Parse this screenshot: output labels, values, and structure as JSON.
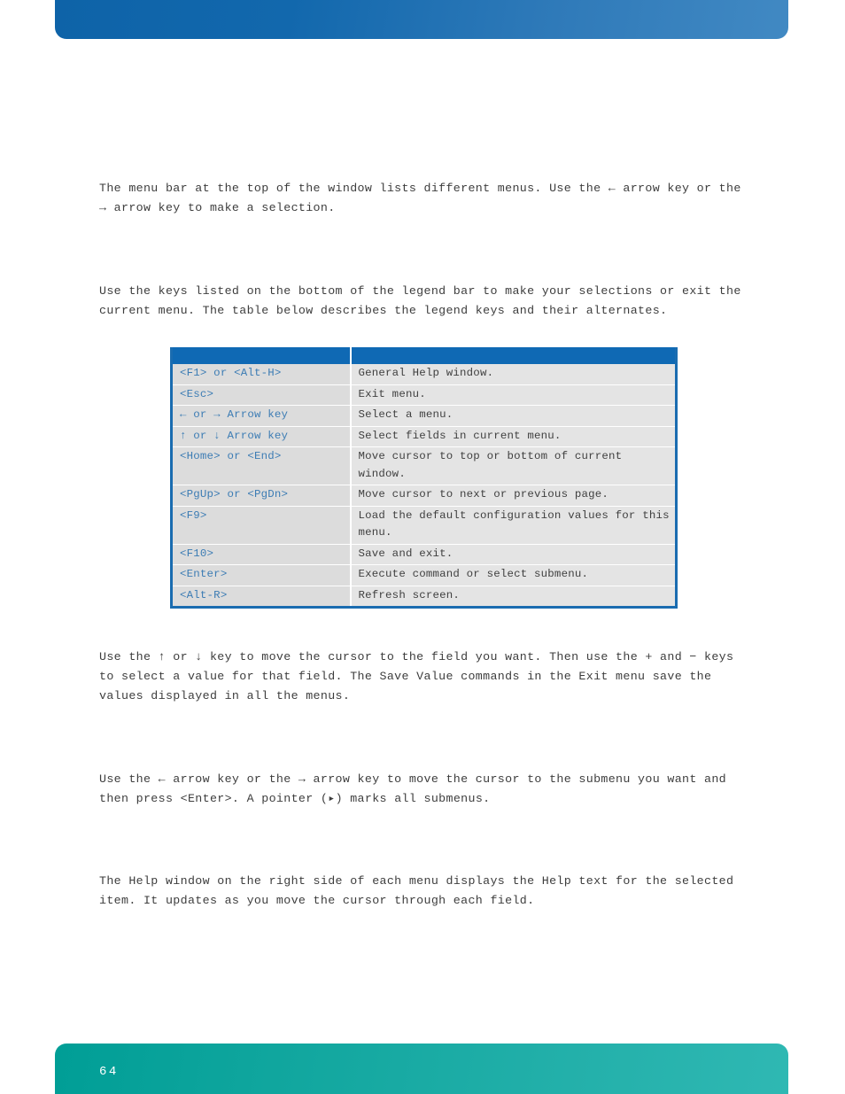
{
  "page": {
    "number": "64",
    "header_color": "#0e63a8",
    "footer_color": "#10a69e",
    "table_border_color": "#1a6cb0",
    "key_text_color": "#3c7cb4"
  },
  "paragraphs": {
    "menu_bar": "The menu bar at the top of the window lists different menus. Use the ← arrow key or the → arrow key to make a selection.",
    "legend_bar": "Use the keys listed on the bottom of the legend bar to make your selections or exit the current menu. The table below describes the legend keys and their alternates.",
    "field_selection": "Use the ↑ or ↓ key to move the cursor to the field you want. Then use the + and − keys to select a value for that field. The Save Value commands in the Exit menu save the values displayed in all the menus.",
    "submenu": "Use the ← arrow key or the → arrow key to move the cursor to the submenu you want and then press <Enter>. A pointer (▸) marks all submenus.",
    "help_window": "The Help window on the right side of each menu displays the Help text for the selected item. It updates as you move the cursor through each field."
  },
  "legend_table": {
    "headers": [
      "",
      ""
    ],
    "rows": [
      {
        "key": "<F1> or <Alt-H>",
        "description": "General Help window."
      },
      {
        "key": "<Esc>",
        "description": "Exit menu."
      },
      {
        "key": "← or → Arrow key",
        "description": "Select a menu."
      },
      {
        "key": "↑ or ↓ Arrow key",
        "description": "Select fields in current menu."
      },
      {
        "key": "<Home> or <End>",
        "description": "Move cursor to top or bottom of current window."
      },
      {
        "key": "<PgUp> or <PgDn>",
        "description": "Move cursor to next or previous page."
      },
      {
        "key": "<F9>",
        "description": "Load the default configuration values for this menu."
      },
      {
        "key": "<F10>",
        "description": "Save and exit."
      },
      {
        "key": "<Enter>",
        "description": "Execute command or select submenu."
      },
      {
        "key": "<Alt-R>",
        "description": "Refresh screen."
      }
    ]
  }
}
